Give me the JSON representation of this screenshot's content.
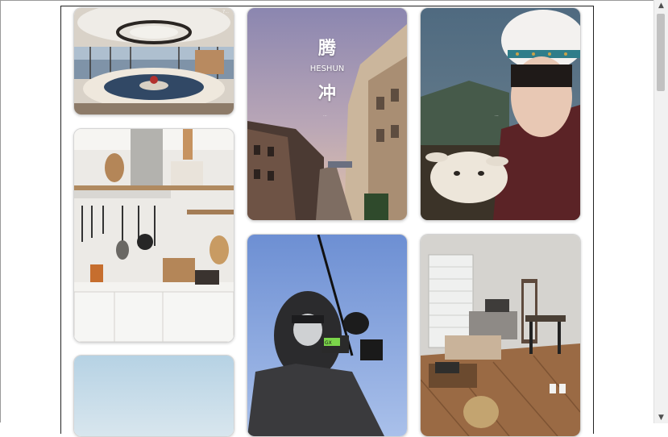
{
  "page": {
    "background": "#ffffff"
  },
  "cards": [
    {
      "name": "living-room-photo",
      "description": "Round sunken sofa living room with ocean view"
    },
    {
      "name": "street-photo",
      "description": "Old town street at sunset",
      "overlay": {
        "line1": "腾",
        "line2": "HESHUN",
        "line3": "冲"
      }
    },
    {
      "name": "portrait-goat-photo",
      "description": "Woman in white fur hat holding a goat"
    },
    {
      "name": "kitchen-photo",
      "description": "Kitchen shelves with hanging utensils"
    },
    {
      "name": "fishing-photo",
      "description": "Masked fisherman holding a rod against blue sky"
    },
    {
      "name": "bedroom-photo",
      "description": "Small bedroom with wooden floor and desk"
    },
    {
      "name": "sky-photo",
      "description": "Pale blue sky image"
    }
  ],
  "scrollbar": {
    "up_arrow": "▲",
    "down_arrow": "▼"
  }
}
